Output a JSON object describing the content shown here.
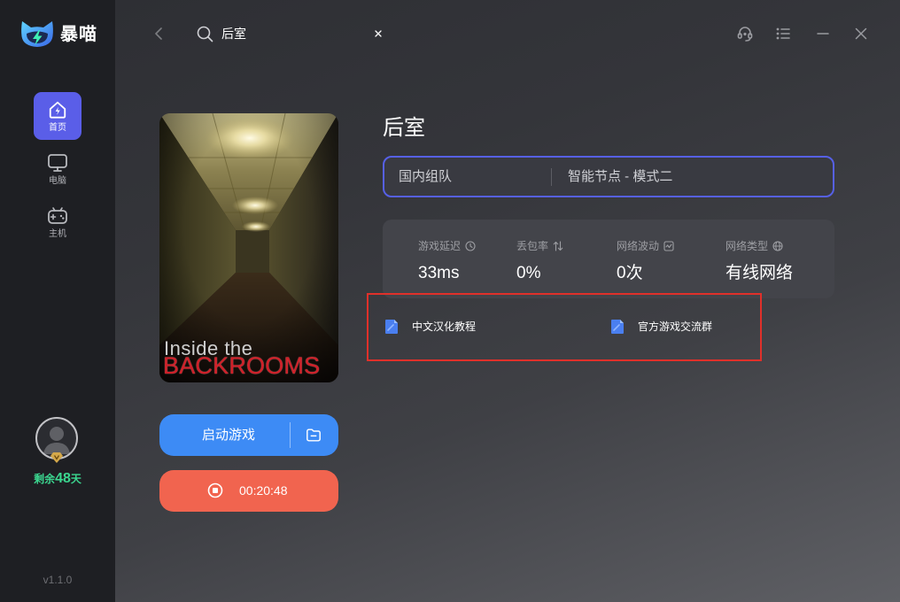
{
  "app": {
    "name": "暴喵",
    "version": "v1.1.0"
  },
  "sidebar": {
    "items": [
      {
        "label": "首页",
        "icon": "home-icon",
        "active": true
      },
      {
        "label": "电脑",
        "icon": "monitor-icon",
        "active": false
      },
      {
        "label": "主机",
        "icon": "gamepad-icon",
        "active": false
      }
    ],
    "user": {
      "remaining_prefix": "剩余",
      "remaining_days": "48",
      "remaining_suffix": "天"
    }
  },
  "topbar": {
    "search_value": "后室",
    "icons": [
      "back-chevron-icon",
      "search-icon",
      "clear-icon",
      "support-headset-icon",
      "menu-list-icon",
      "minimize-icon",
      "close-icon"
    ]
  },
  "game": {
    "title": "后室",
    "cover": {
      "line1": "Inside the",
      "line2": "BACKROOMS"
    },
    "launch_label": "启动游戏",
    "timer": "00:20:48"
  },
  "route": {
    "mode": "国内组队",
    "node": "智能节点 - 模式二"
  },
  "stats": [
    {
      "label": "游戏延迟",
      "value": "33ms",
      "icon": "clock-icon"
    },
    {
      "label": "丢包率",
      "value": "0%",
      "icon": "updown-arrows-icon"
    },
    {
      "label": "网络波动",
      "value": "0次",
      "icon": "wave-chart-icon"
    },
    {
      "label": "网络类型",
      "value": "有线网络",
      "icon": "globe-icon"
    }
  ],
  "links": [
    {
      "label": "中文汉化教程",
      "icon": "document-icon"
    },
    {
      "label": "官方游戏交流群",
      "icon": "document-icon"
    }
  ],
  "colors": {
    "sidebar_bg": "#1e1f23",
    "active_nav": "#5a5ee8",
    "route_border": "#5660e6",
    "launch_button": "#3d8bf5",
    "stop_button": "#f1644f",
    "remaining_text": "#3bd68f",
    "highlight_border": "#e0302a"
  }
}
